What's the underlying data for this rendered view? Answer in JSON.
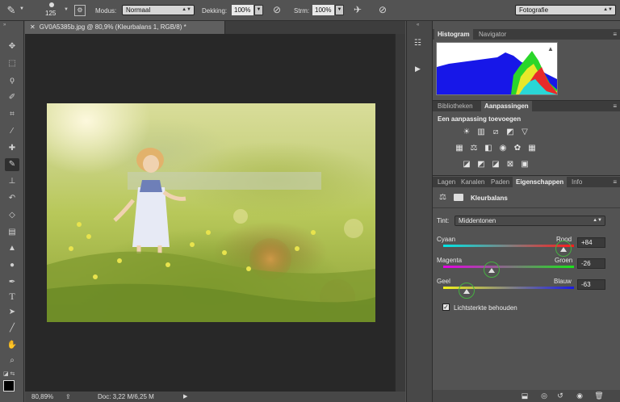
{
  "options_bar": {
    "brush_size": "125",
    "modus_label": "Modus:",
    "modus_value": "Normaal",
    "dekking_label": "Dekking:",
    "dekking_value": "100%",
    "strm_label": "Strm:",
    "strm_value": "100%",
    "workspace_value": "Fotografie"
  },
  "document": {
    "tab_title": "GV0A5385b.jpg @ 80,9% (Kleurbalans 1, RGB/8) *",
    "zoom": "80,89%",
    "doc_info": "Doc: 3,22 M/6,25 M"
  },
  "panels": {
    "top_tabs": [
      "Histogram",
      "Navigator"
    ],
    "middle_tabs": [
      "Bibliotheken",
      "Aanpassingen"
    ],
    "adjust_title": "Een aanpassing toevoegen",
    "bottom_tabs": [
      "Lagen",
      "Kanalen",
      "Paden",
      "Eigenschappen",
      "Info"
    ],
    "properties_title": "Kleurbalans",
    "tint_label": "Tint:",
    "tint_value": "Middentonen",
    "sliders": [
      {
        "left": "Cyaan",
        "right": "Rood",
        "value": "+84",
        "fraction": 0.92
      },
      {
        "left": "Magenta",
        "right": "Groen",
        "value": "-26",
        "fraction": 0.37
      },
      {
        "left": "Geel",
        "right": "Blauw",
        "value": "-63",
        "fraction": 0.18
      }
    ],
    "preserve_label": "Lichtsterkte behouden",
    "preserve_checked": true
  },
  "colors": {
    "background": "#535353",
    "canvas": "#282828",
    "accent_ring": "#46b040"
  },
  "icons": {
    "toolbar": [
      "move-icon",
      "marquee-icon",
      "lasso-icon",
      "quick-select-icon",
      "crop-icon",
      "eyedropper-icon",
      "healing-icon",
      "brush-icon",
      "stamp-icon",
      "history-brush-icon",
      "eraser-icon",
      "gradient-icon",
      "blur-icon",
      "dodge-icon",
      "pen-icon",
      "type-icon",
      "path-select-icon",
      "line-icon",
      "hand-icon",
      "zoom-icon"
    ]
  }
}
